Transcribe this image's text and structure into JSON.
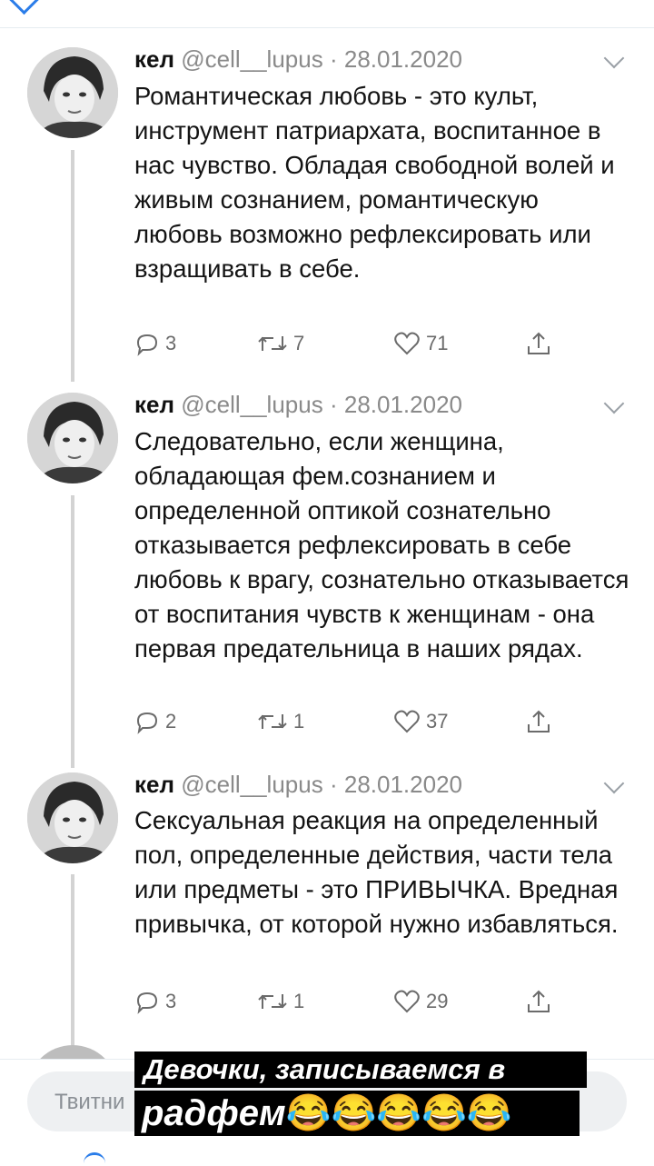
{
  "tweets": [
    {
      "name": "кел",
      "handle": "@cell__lupus",
      "sep": "·",
      "date": "28.01.2020",
      "text": "Романтическая любовь - это культ, инструмент патриархата, воспитанное в нас чувство. Обладая свободной волей и живым сознанием, романтическую любовь возможно рефлексировать или взращивать в себе.",
      "replies": "3",
      "retweets": "7",
      "likes": "71"
    },
    {
      "name": "кел",
      "handle": "@cell__lupus",
      "sep": "·",
      "date": "28.01.2020",
      "text": "Следовательно, если женщина, обладающая фем.сознанием и определенной оптикой сознательно отказывается рефлексировать в себе любовь к врагу, сознательно отказывается от воспитания чувств к женщинам - она первая предательница в наших рядах.",
      "replies": "2",
      "retweets": "1",
      "likes": "37"
    },
    {
      "name": "кел",
      "handle": "@cell__lupus",
      "sep": "·",
      "date": "28.01.2020",
      "text": "Сексуальная реакция на определенный пол, определенные действия, части тела или предметы - это ПРИВЫЧКА. Вредная привычка, от которой нужно избавляться.",
      "replies": "3",
      "retweets": "1",
      "likes": "29"
    }
  ],
  "reply_placeholder": "Твитни",
  "caption": {
    "line1": "Девочки, записываемся в",
    "line2": "радфем",
    "emojis": "😂😂😂😂😂"
  },
  "colors": {
    "accent": "#2b7de9",
    "muted": "#8a8a8a",
    "caption_bg": "#000000"
  }
}
